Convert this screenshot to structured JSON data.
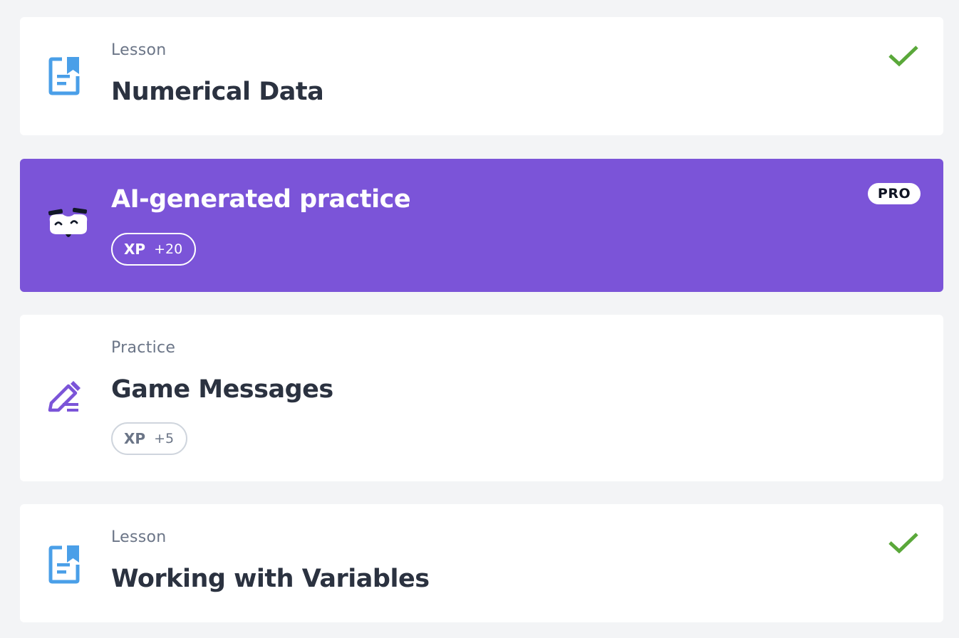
{
  "items": [
    {
      "kind": "Lesson",
      "title": "Numerical Data",
      "icon": "lesson-doc-icon",
      "status": "completed"
    },
    {
      "title": "AI-generated practice",
      "icon": "mascot-icon",
      "badge": "PRO",
      "xp_label": "XP",
      "xp_value": "+20"
    },
    {
      "kind": "Practice",
      "title": "Game Messages",
      "icon": "pencil-icon",
      "xp_label": "XP",
      "xp_value": "+5"
    },
    {
      "kind": "Lesson",
      "title": "Working with Variables",
      "icon": "lesson-doc-icon",
      "status": "completed"
    }
  ],
  "colors": {
    "background": "#f3f4f6",
    "card": "#ffffff",
    "promo_card": "#7b54d8",
    "title_text": "#2b3240",
    "muted_text": "#6b7587",
    "check_green": "#5aa83a",
    "lesson_icon_blue": "#4a9fe8",
    "practice_icon_purple": "#7b54d8"
  }
}
